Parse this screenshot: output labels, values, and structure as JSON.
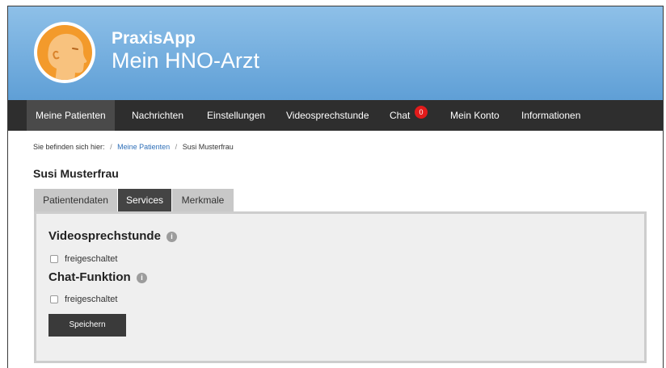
{
  "header": {
    "app_name": "PraxisApp",
    "subtitle": "Mein HNO-Arzt",
    "logo_icon": "head-profile-icon",
    "colors": {
      "header_top": "#8ec0e8",
      "header_bottom": "#5f9fd6",
      "logo_bg": "#f39a2b"
    }
  },
  "nav": {
    "items": [
      {
        "label": "Meine Patienten",
        "active": true
      },
      {
        "label": "Nachrichten"
      },
      {
        "label": "Einstellungen"
      },
      {
        "label": "Videosprechstunde"
      },
      {
        "label": "Chat",
        "badge": "0"
      },
      {
        "label": "Mein Konto"
      },
      {
        "label": "Informationen"
      }
    ],
    "colors": {
      "background": "#2e2e2e",
      "active": "#4a4a4a",
      "badge": "#e21b1b"
    }
  },
  "breadcrumb": {
    "prefix": "Sie befinden sich hier:",
    "separator": "/",
    "items": [
      "Meine Patienten",
      "Susi Musterfrau"
    ]
  },
  "patient": {
    "name": "Susi Musterfrau"
  },
  "tabs": [
    {
      "label": "Patientendaten"
    },
    {
      "label": "Services",
      "active": true
    },
    {
      "label": "Merkmale"
    }
  ],
  "services": {
    "sections": [
      {
        "title": "Videosprechstunde",
        "info_icon": "info-icon",
        "checkbox_label": "freigeschaltet",
        "checked": false
      },
      {
        "title": "Chat-Funktion",
        "info_icon": "info-icon",
        "checkbox_label": "freigeschaltet",
        "checked": false
      }
    ],
    "save_label": "Speichern"
  }
}
